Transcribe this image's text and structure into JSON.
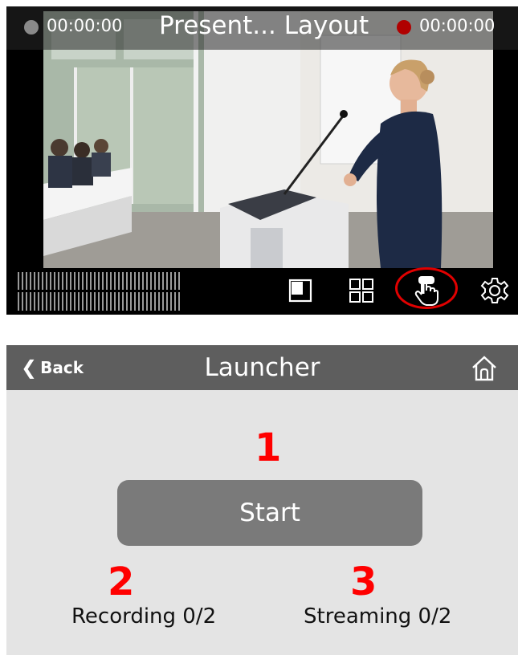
{
  "monitor": {
    "left_timer": "00:00:00",
    "layout_name": "Present... Layout",
    "right_timer": "00:00:00",
    "controls": [
      "single-layout-icon",
      "grid-layout-icon",
      "touch-hand-icon",
      "gear-icon"
    ]
  },
  "launcher": {
    "back_label": "Back",
    "back_chevron": "❮",
    "title": "Launcher",
    "start_label": "Start",
    "recording_label": "Recording 0/2",
    "streaming_label": "Streaming 0/2",
    "callouts": [
      "1",
      "2",
      "3"
    ]
  },
  "colors": {
    "header_bg": "#5e5e5e",
    "button_bg": "#7a7a7a",
    "panel_bg": "#e4e4e4",
    "callout": "#ff0000",
    "record_led": "#b00000"
  }
}
